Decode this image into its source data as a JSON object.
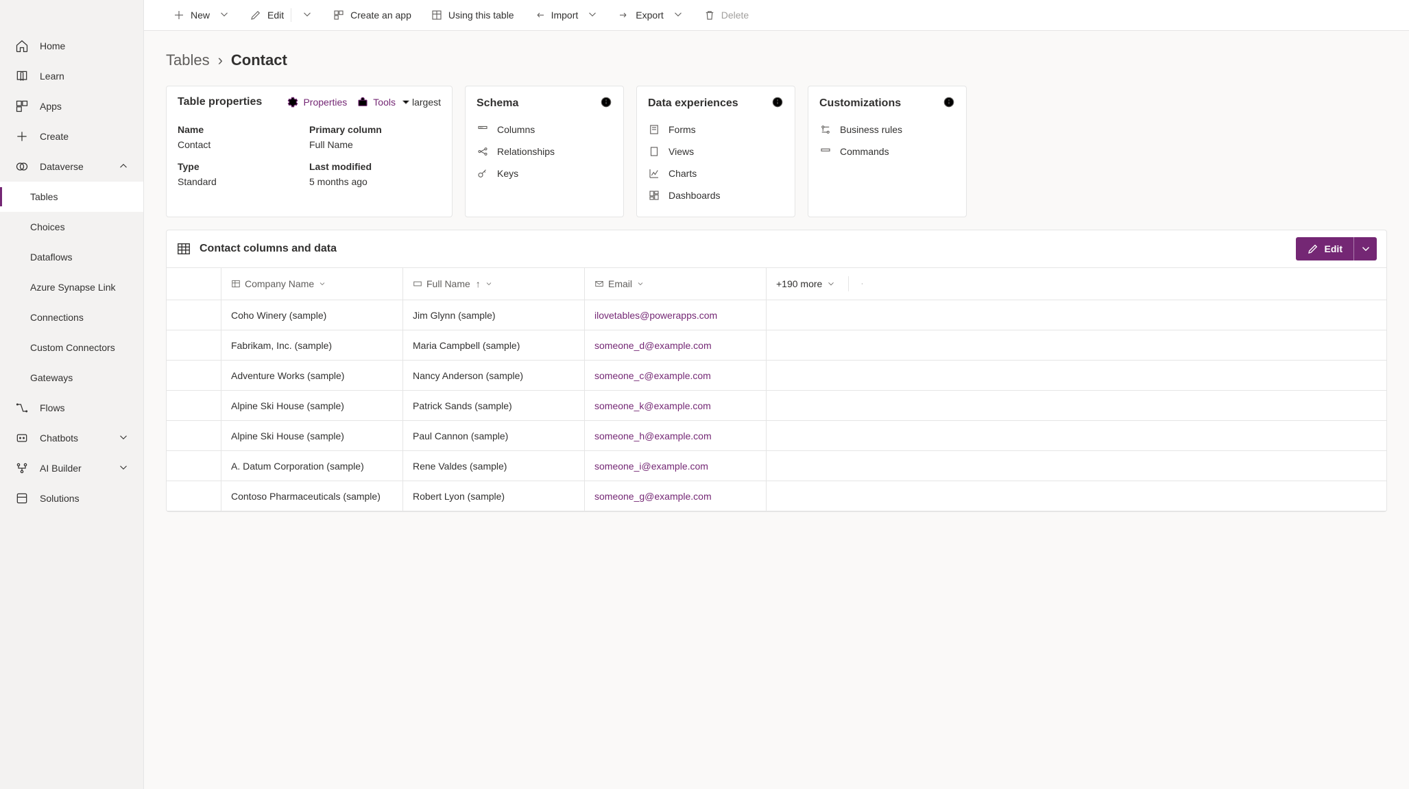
{
  "sidebar": {
    "items": [
      {
        "label": "Home"
      },
      {
        "label": "Learn"
      },
      {
        "label": "Apps"
      },
      {
        "label": "Create"
      },
      {
        "label": "Dataverse"
      },
      {
        "label": "Tables"
      },
      {
        "label": "Choices"
      },
      {
        "label": "Dataflows"
      },
      {
        "label": "Azure Synapse Link"
      },
      {
        "label": "Connections"
      },
      {
        "label": "Custom Connectors"
      },
      {
        "label": "Gateways"
      },
      {
        "label": "Flows"
      },
      {
        "label": "Chatbots"
      },
      {
        "label": "AI Builder"
      },
      {
        "label": "Solutions"
      }
    ]
  },
  "toolbar": {
    "new": "New",
    "edit": "Edit",
    "create_app": "Create an app",
    "using_table": "Using this table",
    "import": "Import",
    "export": "Export",
    "delete": "Delete"
  },
  "breadcrumb": {
    "root": "Tables",
    "current": "Contact"
  },
  "props_card": {
    "title": "Table properties",
    "properties_link": "Properties",
    "tools_link": "Tools",
    "name_label": "Name",
    "name_val": "Contact",
    "primary_label": "Primary column",
    "primary_val": "Full Name",
    "type_label": "Type",
    "type_val": "Standard",
    "modified_label": "Last modified",
    "modified_val": "5 months ago"
  },
  "schema_card": {
    "title": "Schema",
    "columns": "Columns",
    "relationships": "Relationships",
    "keys": "Keys"
  },
  "exp_card": {
    "title": "Data experiences",
    "forms": "Forms",
    "views": "Views",
    "charts": "Charts",
    "dashboards": "Dashboards"
  },
  "cust_card": {
    "title": "Customizations",
    "rules": "Business rules",
    "commands": "Commands"
  },
  "data_section": {
    "title": "Contact columns and data",
    "edit": "Edit",
    "more": "+190 more",
    "columns": {
      "company": "Company Name",
      "fullname": "Full Name",
      "email": "Email"
    },
    "rows": [
      {
        "company": "Coho Winery (sample)",
        "name": "Jim Glynn (sample)",
        "email": "ilovetables@powerapps.com"
      },
      {
        "company": "Fabrikam, Inc. (sample)",
        "name": "Maria Campbell (sample)",
        "email": "someone_d@example.com"
      },
      {
        "company": "Adventure Works (sample)",
        "name": "Nancy Anderson (sample)",
        "email": "someone_c@example.com"
      },
      {
        "company": "Alpine Ski House (sample)",
        "name": "Patrick Sands (sample)",
        "email": "someone_k@example.com"
      },
      {
        "company": "Alpine Ski House (sample)",
        "name": "Paul Cannon (sample)",
        "email": "someone_h@example.com"
      },
      {
        "company": "A. Datum Corporation (sample)",
        "name": "Rene Valdes (sample)",
        "email": "someone_i@example.com"
      },
      {
        "company": "Contoso Pharmaceuticals (sample)",
        "name": "Robert Lyon (sample)",
        "email": "someone_g@example.com"
      }
    ]
  }
}
